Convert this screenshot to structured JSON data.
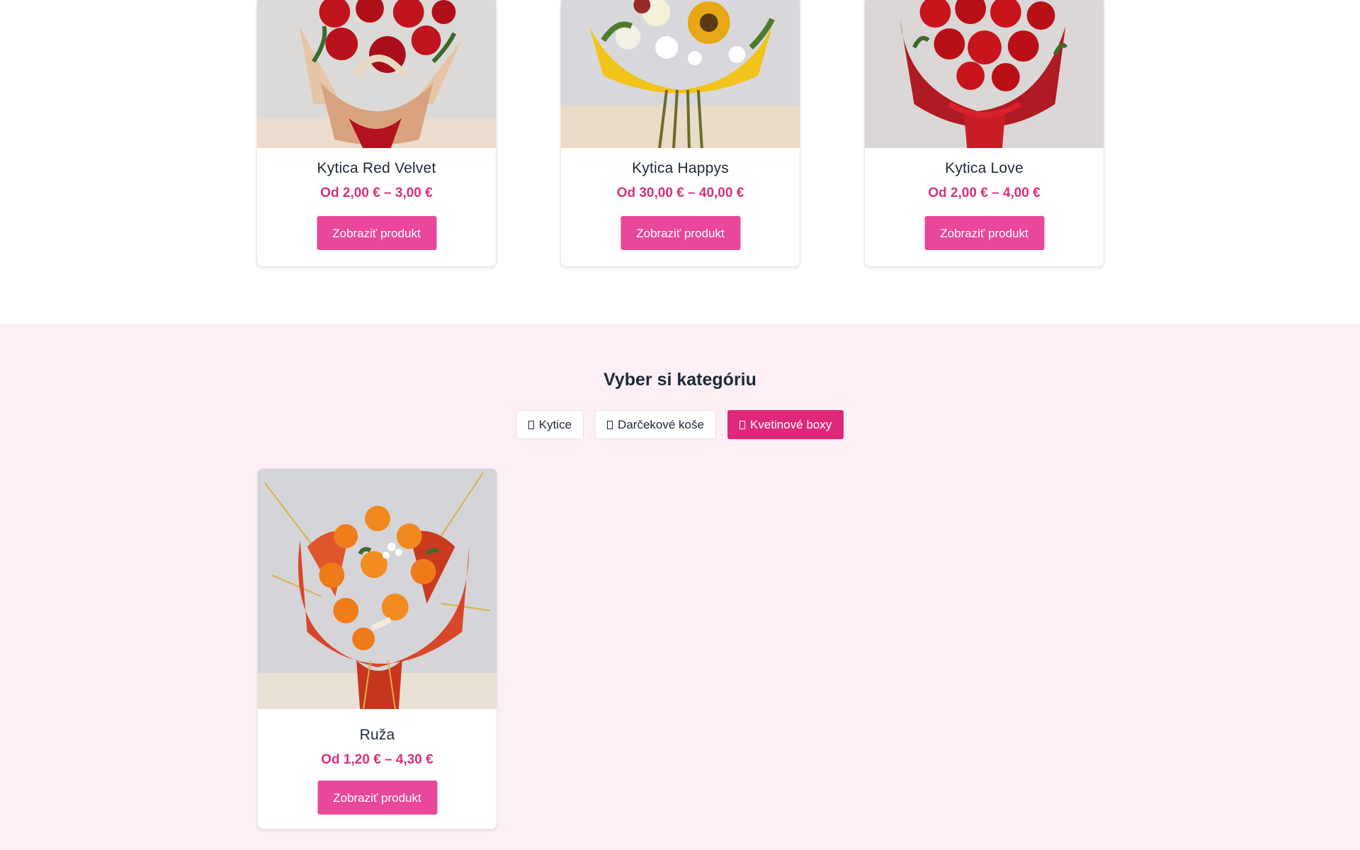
{
  "featured_products": [
    {
      "name": "Kytica Red Velvet",
      "price": "Od 2,00 € – 3,00 €",
      "button": "Zobraziť produkt"
    },
    {
      "name": "Kytica Happys",
      "price": "Od 30,00 € – 40,00 €",
      "button": "Zobraziť produkt"
    },
    {
      "name": "Kytica Love",
      "price": "Od 2,00 € – 4,00 €",
      "button": "Zobraziť produkt"
    }
  ],
  "categories": {
    "title": "Vyber si kategóriu",
    "tabs": [
      {
        "label": "Kytice",
        "active": false
      },
      {
        "label": "Darčekové koše",
        "active": false
      },
      {
        "label": "Kvetinové boxy",
        "active": true
      }
    ],
    "products": [
      {
        "name": "Ruža",
        "price": "Od 1,20 € – 4,30 €",
        "button": "Zobraziť produkt"
      }
    ]
  },
  "colors": {
    "accent": "#e9489a",
    "active_tab": "#e0287a",
    "price": "#d6307a",
    "section_bg": "#fcf0f6"
  }
}
